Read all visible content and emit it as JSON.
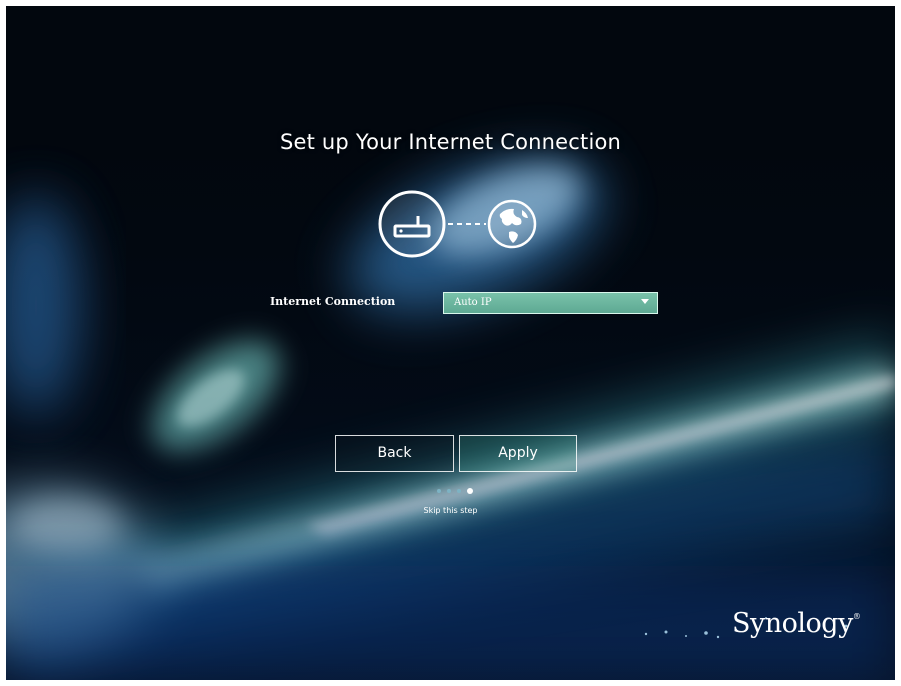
{
  "page": {
    "title": "Set up Your Internet Connection"
  },
  "graphic": {
    "device_icon": "router-icon",
    "target_icon": "globe-icon"
  },
  "form": {
    "internet_connection_label": "Internet Connection",
    "internet_connection_value": "Auto IP"
  },
  "buttons": {
    "back_label": "Back",
    "apply_label": "Apply"
  },
  "progress": {
    "total_steps": 4,
    "current_step": 4
  },
  "skip_label": "Skip this step",
  "brand": {
    "name": "Synology",
    "mark": "®"
  },
  "colors": {
    "accent": "#79c2aa",
    "background": "#02060c"
  }
}
